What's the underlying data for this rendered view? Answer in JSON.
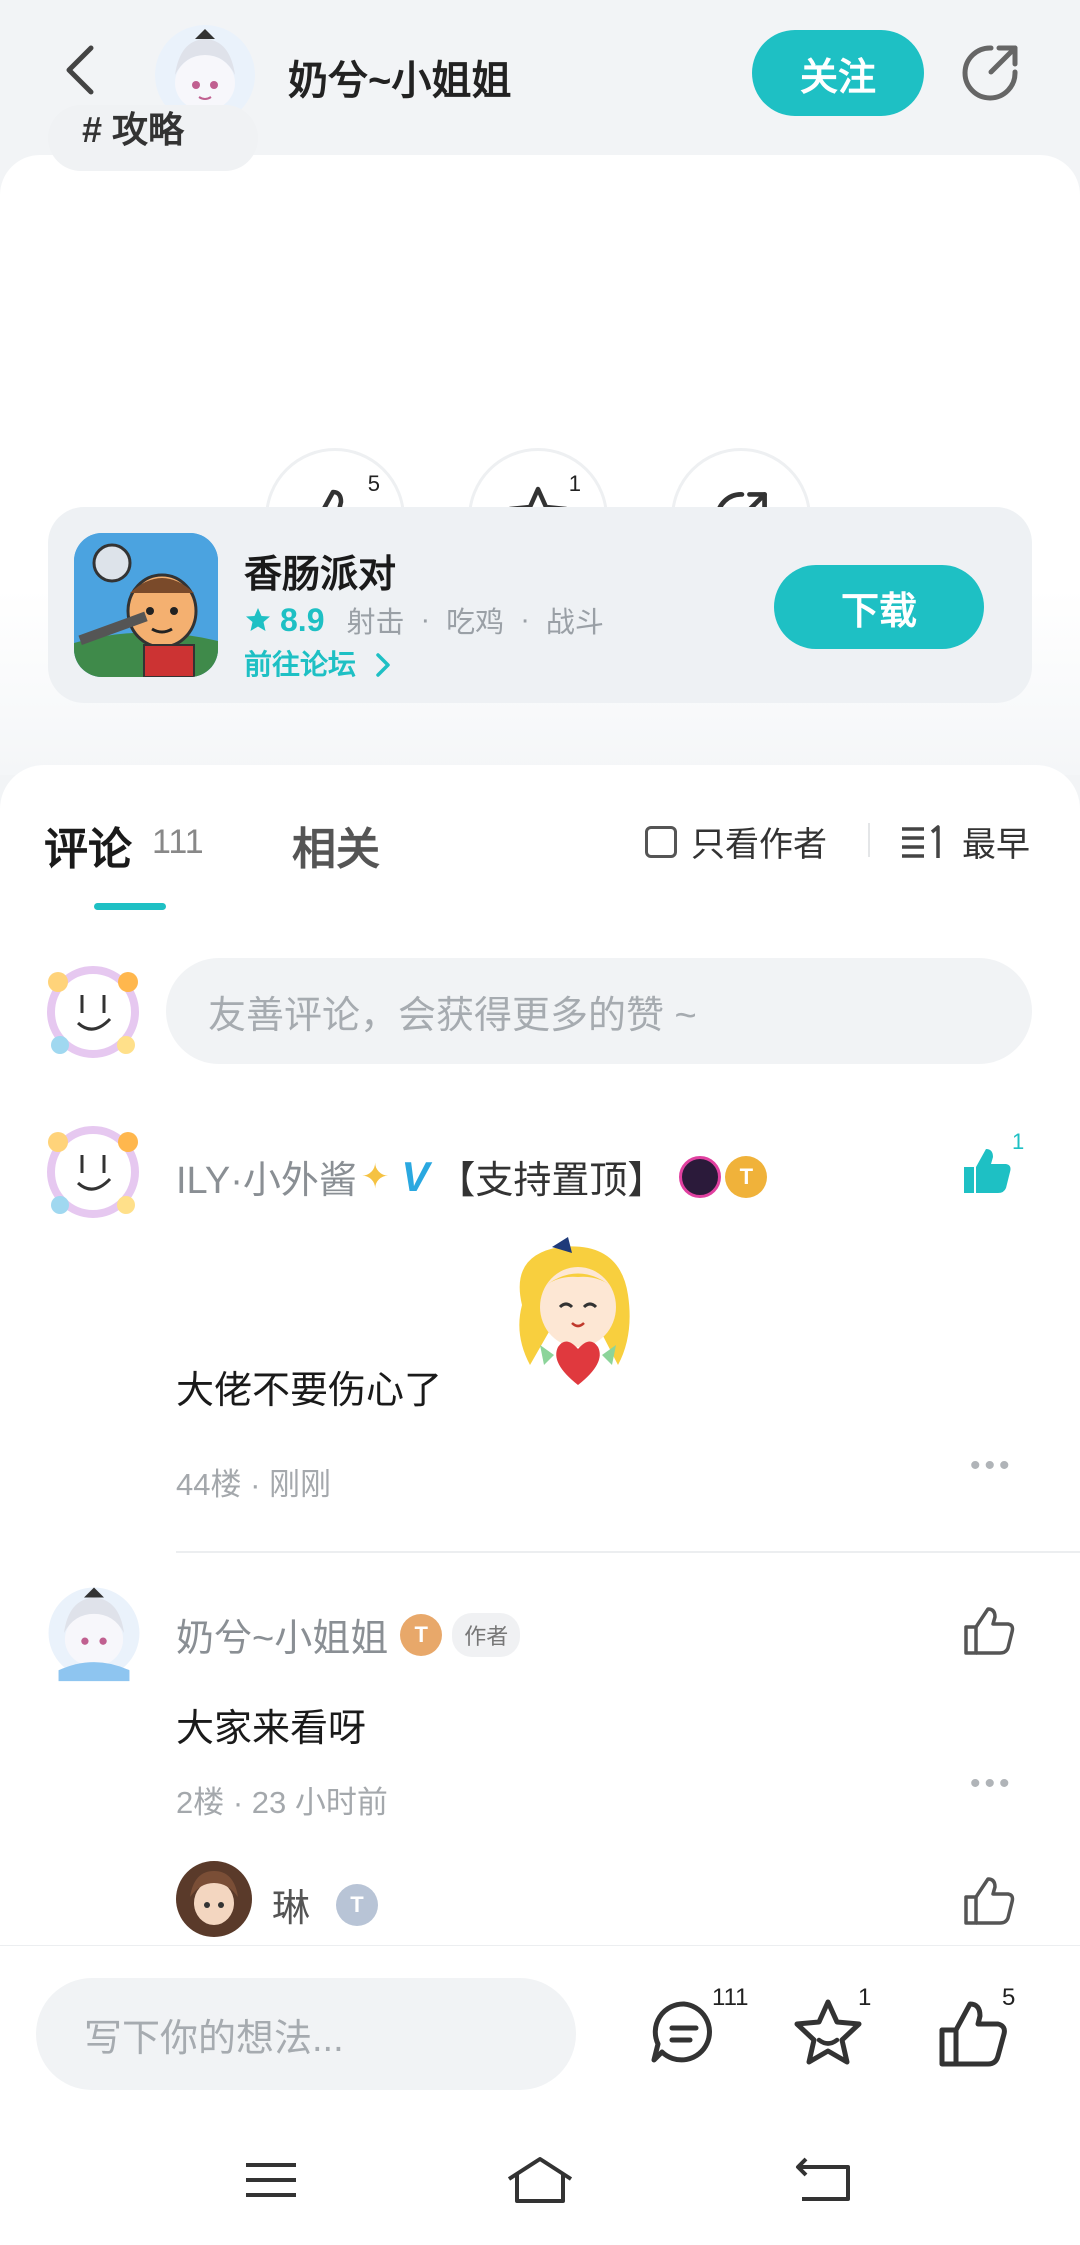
{
  "header": {
    "author_name": "奶兮~小姐姐",
    "follow_label": "关注"
  },
  "post": {
    "tag_label": "# 攻略",
    "like_count": "5",
    "favorite_count": "1"
  },
  "game": {
    "name": "香肠派对",
    "rating": "8.9",
    "tags": [
      "射击",
      "吃鸡",
      "战斗"
    ],
    "forum_link": "前往论坛",
    "download_label": "下载"
  },
  "comments_section": {
    "tab_comments": "评论",
    "comment_count": "111",
    "tab_related": "相关",
    "filter_author_only": "只看作者",
    "sort_label": "最早",
    "input_placeholder": "友善评论，会获得更多的赞 ~"
  },
  "comments": [
    {
      "username": "ILY·小外酱",
      "flair": "【支持置顶】",
      "text": "大佬不要伤心了",
      "floor_time": "44楼 · 刚刚",
      "likes": "1"
    },
    {
      "username": "奶兮~小姐姐",
      "author_badge": "作者",
      "text": "大家来看呀",
      "floor_time": "2楼 · 23 小时前"
    },
    {
      "username": "琳"
    }
  ],
  "bottom_bar": {
    "input_placeholder": "写下你的想法...",
    "comment_count": "111",
    "favorite_count": "1",
    "like_count": "5"
  },
  "colors": {
    "accent": "#1ec0c4",
    "background": "#f2f4f6"
  },
  "icons": [
    "back-icon",
    "share-icon",
    "thumbs-up-icon",
    "star-icon",
    "star-rating-icon",
    "chevron-right-icon",
    "checkbox-icon",
    "sort-icon",
    "more-icon",
    "comment-icon",
    "menu-icon",
    "home-icon",
    "return-icon"
  ]
}
